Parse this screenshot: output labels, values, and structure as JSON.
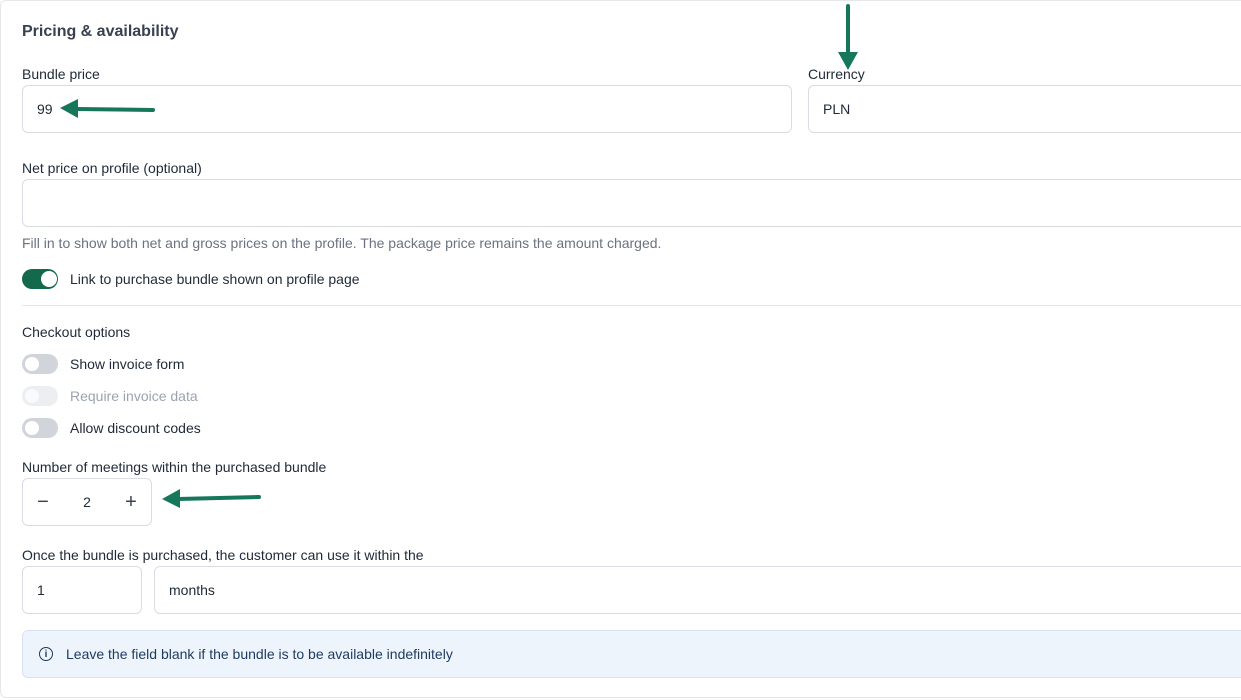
{
  "section": {
    "title": "Pricing & availability"
  },
  "bundle_price": {
    "label": "Bundle price",
    "value": "99"
  },
  "currency": {
    "label": "Currency",
    "value": "PLN"
  },
  "net_price": {
    "label": "Net price on profile (optional)",
    "value": "",
    "helper": "Fill in to show both net and gross prices on the profile. The package price remains the amount charged."
  },
  "profile_link_toggle": {
    "label": "Link to purchase bundle shown on profile page",
    "state": "on"
  },
  "checkout": {
    "title": "Checkout options",
    "options": [
      {
        "label": "Show invoice form",
        "state": "off"
      },
      {
        "label": "Require invoice data",
        "state": "disabled"
      },
      {
        "label": "Allow discount codes",
        "state": "off"
      }
    ]
  },
  "meetings": {
    "label": "Number of meetings within the purchased bundle",
    "value": "2",
    "decrement_symbol": "−",
    "increment_symbol": "+"
  },
  "validity": {
    "label": "Once the bundle is purchased, the customer can use it within the",
    "amount": "1",
    "unit": "months"
  },
  "info": {
    "icon": "info-icon",
    "text": "Leave the field blank if the bundle is to be available indefinitely"
  },
  "colors": {
    "accent": "#14694d",
    "annotation_arrow": "#16775a",
    "info_background": "#eef4fb"
  }
}
